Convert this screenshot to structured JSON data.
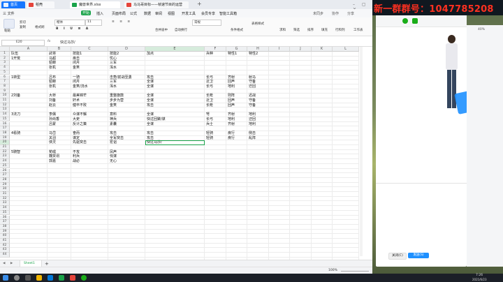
{
  "tabs": [
    {
      "label": "首页",
      "color": "#1677ff"
    },
    {
      "label": "稻壳",
      "color": "#e5443b"
    },
    {
      "label": "魔兽世界.xlsx",
      "color": "#1aa34a"
    },
    {
      "label": "马马哥目标——帧速节目的运营",
      "color": "#e5443b"
    }
  ],
  "new_tab": "+",
  "menu": {
    "file": "三 文件",
    "items": [
      "开始",
      "插入",
      "页面布局",
      "公式",
      "数据",
      "审阅",
      "视图",
      "开发工具",
      "会员专享",
      "智能工具箱"
    ],
    "active": "开始",
    "right": [
      "未同步",
      "协作",
      "分享"
    ]
  },
  "ribbon": {
    "paste": "粘贴",
    "cut": "剪切",
    "copy": "复制",
    "format_painter": "格式刷",
    "font_name": "楷体",
    "font_size": "11",
    "merge": "合并居中",
    "wrap": "自动换行",
    "number_format": "常规",
    "cond_format": "条件格式",
    "table_style": "表格样式",
    "sum": "求和",
    "filter": "筛选",
    "sort": "排序",
    "fill": "填充",
    "rowcol": "行和列",
    "worksheet": "工作表"
  },
  "formula": {
    "cellref": "E20",
    "fx": "fx",
    "content": "快过马莎/"
  },
  "columns": [
    "A",
    "B",
    "C",
    "D",
    "E",
    "F",
    "G",
    "H",
    "I",
    "J",
    "K",
    "L"
  ],
  "rows": [
    {
      "n": "1",
      "cells": {
        "A": "队伍",
        "B": "武将",
        "C": "技能1",
        "D": "技能2",
        "E": "加点",
        "F": "兵种",
        "G": "特性1",
        "H": "特性2"
      }
    },
    {
      "n": "2",
      "cells": {
        "A": "1开荒",
        "B": "马超",
        "C": "疾击",
        "D": "忧心"
      }
    },
    {
      "n": "3",
      "cells": {
        "B": "貂蝉",
        "C": "闭月",
        "D": "三军"
      }
    },
    {
      "n": "4",
      "cells": {
        "B": "张机",
        "C": "金笑",
        "D": "浑水"
      }
    },
    {
      "n": "5",
      "cells": {}
    },
    {
      "n": "6",
      "cells": {
        "A": "1转型",
        "B": "吕布",
        "C": "一骑",
        "D": "击势/前战至勇",
        "E": "攻击",
        "F": "长弓",
        "G": "齐射",
        "H": "射马"
      }
    },
    {
      "n": "7",
      "cells": {
        "B": "貂蝉",
        "C": "闭月",
        "D": "三军",
        "E": "全谋",
        "F": "近卫",
        "G": "回声",
        "H": "守备"
      }
    },
    {
      "n": "8",
      "cells": {
        "B": "张机",
        "C": "金笑/浇水",
        "D": "浑水",
        "E": "全谋",
        "F": "长弓",
        "G": "地利",
        "H": "迁回"
      }
    },
    {
      "n": "9",
      "cells": {}
    },
    {
      "n": "10",
      "cells": {
        "A": "2刘备",
        "B": "大桥",
        "C": "最美锦芒",
        "D": "重整旗鼓",
        "E": "全谋",
        "F": "长枪",
        "G": "则阵",
        "H": "迟战"
      }
    },
    {
      "n": "11",
      "cells": {
        "B": "刘备",
        "C": "奸术",
        "D": "步步为营",
        "E": "全谋",
        "F": "近卫",
        "G": "回声",
        "H": "守备"
      }
    },
    {
      "n": "12",
      "cells": {
        "B": "赵云",
        "C": "健卒不败",
        "D": "金笑",
        "E": "攻击",
        "F": "长枪",
        "G": "回声",
        "H": "守备"
      }
    },
    {
      "n": "13",
      "cells": {}
    },
    {
      "n": "14",
      "cells": {
        "A": "3法刀",
        "B": "李儒",
        "C": "众谋不懈",
        "D": "意料",
        "E": "全谋",
        "F": "弩",
        "G": "齐射",
        "H": "地利"
      }
    },
    {
      "n": "15",
      "cells": {
        "B": "孙尚香",
        "C": "大吏",
        "D": "神兵",
        "E": "快过回聚/谋",
        "F": "长弓",
        "G": "地利",
        "H": "迂回"
      }
    },
    {
      "n": "16",
      "cells": {
        "B": "吕蒙",
        "C": "反计之策",
        "D": "素囊",
        "E": "全谋",
        "F": "兵士",
        "G": "齐射",
        "H": "地利"
      }
    },
    {
      "n": "17",
      "cells": {}
    },
    {
      "n": "18",
      "cells": {
        "A": "4看骑",
        "B": "马岱",
        "C": "奋而",
        "D": "攻击",
        "E": "攻击",
        "F": "轻骑",
        "G": "疾行",
        "H": "侧击"
      }
    },
    {
      "n": "19",
      "cells": {
        "B": "关羽",
        "C": "谋定",
        "D": "全军突击",
        "E": "攻击",
        "F": "轻骑",
        "G": "疾行",
        "H": "乱阵"
      }
    },
    {
      "n": "20",
      "cells": {
        "B": "侠灵",
        "C": "先驱突击",
        "D": "宏诅",
        "E": "快过马莎/"
      }
    },
    {
      "n": "21",
      "cells": {}
    },
    {
      "n": "22",
      "cells": {
        "A": "5騎智",
        "B": "荀彧",
        "C": "不攻",
        "D": "凤声"
      }
    },
    {
      "n": "23",
      "cells": {
        "B": "魏贾诩",
        "C": "利兵",
        "D": "伐谋"
      }
    },
    {
      "n": "24",
      "cells": {
        "B": "郭嘉",
        "C": "战必",
        "D": "无心"
      }
    },
    {
      "n": "25",
      "cells": {}
    },
    {
      "n": "26",
      "cells": {}
    },
    {
      "n": "27",
      "cells": {}
    },
    {
      "n": "28",
      "cells": {}
    },
    {
      "n": "29",
      "cells": {}
    },
    {
      "n": "30",
      "cells": {}
    },
    {
      "n": "31",
      "cells": {}
    },
    {
      "n": "32",
      "cells": {}
    },
    {
      "n": "33",
      "cells": {}
    },
    {
      "n": "34",
      "cells": {}
    },
    {
      "n": "35",
      "cells": {}
    },
    {
      "n": "36",
      "cells": {}
    },
    {
      "n": "37",
      "cells": {}
    },
    {
      "n": "38",
      "cells": {}
    },
    {
      "n": "39",
      "cells": {}
    },
    {
      "n": "40",
      "cells": {}
    },
    {
      "n": "41",
      "cells": {}
    },
    {
      "n": "42",
      "cells": {}
    },
    {
      "n": "43",
      "cells": {}
    },
    {
      "n": "44",
      "cells": {}
    }
  ],
  "active_cell": "E20",
  "sheet": {
    "name": "Sheet1",
    "add": "+"
  },
  "status": {
    "zoom": "100%"
  },
  "promo": "新一群群号：1047785208",
  "chat": {
    "close_btn": "关闭(C)",
    "send_btn": "发送(S)",
    "percent": "40%"
  },
  "taskbar": {
    "time": "7:26",
    "date": "2021/6/23"
  },
  "colors": {
    "accent": "#1aa34a",
    "selection": "#1aa34a",
    "promo_text": "#ff3020",
    "chat_send": "#1e90ff"
  }
}
